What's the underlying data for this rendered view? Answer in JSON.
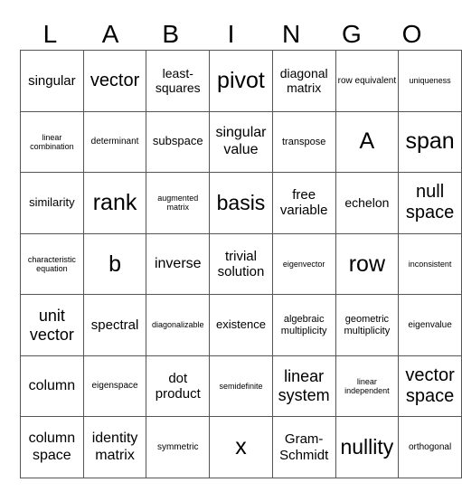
{
  "header": {
    "letters": [
      "L",
      "A",
      "B",
      "I",
      "N",
      "G",
      "O"
    ]
  },
  "grid": {
    "rows": [
      [
        "singular",
        "vector",
        "least-squares",
        "pivot",
        "diagonal matrix",
        "row equivalent",
        "uniqueness"
      ],
      [
        "linear combination",
        "determinant",
        "subspace",
        "singular value",
        "transpose",
        "A",
        "span"
      ],
      [
        "similarity",
        "rank",
        "augmented matrix",
        "basis",
        "free variable",
        "echelon",
        "null space"
      ],
      [
        "characteristic equation",
        "b",
        "inverse",
        "trivial solution",
        "eigenvector",
        "row",
        "inconsistent"
      ],
      [
        "unit vector",
        "spectral",
        "diagonalizable",
        "existence",
        "algebraic multiplicity",
        "geometric multiplicity",
        "eigenvalue"
      ],
      [
        "column",
        "eigenspace",
        "dot product",
        "semidefinite",
        "linear system",
        "linear independent",
        "vector space"
      ],
      [
        "column space",
        "identity matrix",
        "symmetric",
        "x",
        "Gram-Schmidt",
        "nullity",
        "orthogonal"
      ]
    ]
  }
}
